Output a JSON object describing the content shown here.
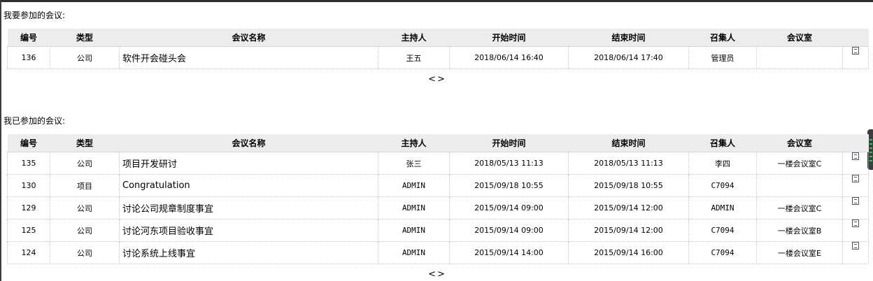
{
  "columns": [
    "编号",
    "类型",
    "会议名称",
    "主持人",
    "开始时间",
    "结束时间",
    "召集人",
    "会议室"
  ],
  "upcoming": {
    "title": "我要参加的会议:",
    "rows": [
      {
        "id": "136",
        "type": "公司",
        "name": "软件开会碰头会",
        "host": "王五",
        "start": "2018/06/14 16:40",
        "end": "2018/06/14 17:40",
        "convener": "管理员",
        "room": ""
      }
    ]
  },
  "attended": {
    "title": "我已参加的会议:",
    "rows": [
      {
        "id": "135",
        "type": "公司",
        "name": "项目开发研讨",
        "host": "张三",
        "start": "2018/05/13 11:13",
        "end": "2018/05/13 11:13",
        "convener": "李四",
        "room": "一楼会议室C"
      },
      {
        "id": "130",
        "type": "项目",
        "name": "Congratulation",
        "host": "ADMIN",
        "start": "2015/09/18 10:55",
        "end": "2015/09/18 10:55",
        "convener": "C7094",
        "room": ""
      },
      {
        "id": "129",
        "type": "公司",
        "name": "讨论公司规章制度事宜",
        "host": "ADMIN",
        "start": "2015/09/14 09:00",
        "end": "2015/09/14 12:00",
        "convener": "ADMIN",
        "room": "一楼会议室C"
      },
      {
        "id": "125",
        "type": "公司",
        "name": "讨论河东项目验收事宜",
        "host": "ADMIN",
        "start": "2015/09/14 09:00",
        "end": "2015/09/14 12:00",
        "convener": "C7094",
        "room": "一楼会议室B"
      },
      {
        "id": "124",
        "type": "公司",
        "name": "讨论系统上线事宜",
        "host": "ADMIN",
        "start": "2015/09/14 14:00",
        "end": "2015/09/14 16:00",
        "convener": "C7094",
        "room": "一楼会议室E"
      }
    ]
  },
  "pager": {
    "prev": "<",
    "next": ">"
  },
  "icons": {
    "row_action": "document-copy-icon"
  }
}
